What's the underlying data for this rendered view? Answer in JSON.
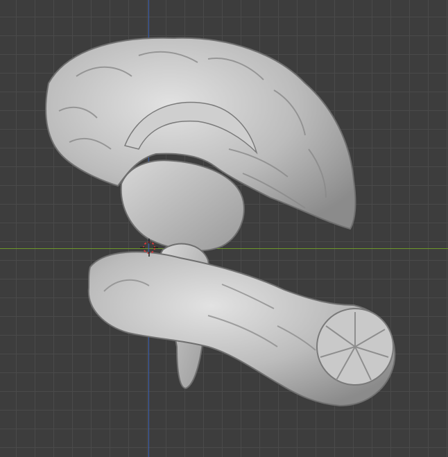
{
  "viewport": {
    "type": "3d-viewport",
    "background_color": "#3d3d3d",
    "grid_color": "#4a4a4a",
    "x_axis_color": "#6e9a2a",
    "y_axis_color": "#3a5fb0"
  },
  "model": {
    "description_icon": "brain-sagittal-section-model",
    "material_color": "#bdbdbd"
  },
  "cursor": {
    "icon": "3d-cursor-icon",
    "color": "#d33a3a"
  }
}
